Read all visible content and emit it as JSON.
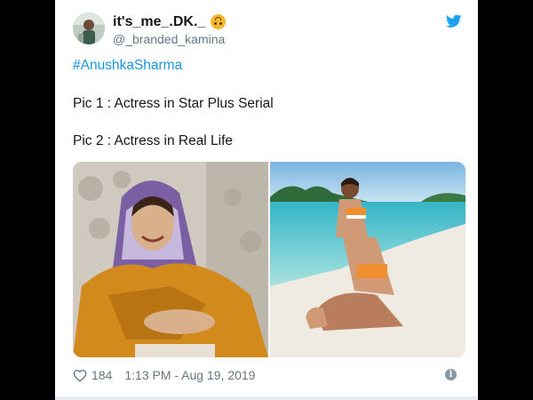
{
  "tweet": {
    "display_name": "it's_me_.DK._",
    "handle": "@_branded_kamina",
    "hashtag": "#AnushkaSharma",
    "lines": [
      "Pic 1 : Actress in Star Plus Serial",
      "Pic 2 : Actress in Real Life"
    ],
    "likes": "184",
    "timestamp": "1:13 PM - Aug 19, 2019"
  },
  "icons": {
    "brand": "twitter-bird-icon",
    "emoji": "upside-down-face-emoji",
    "like": "heart-icon",
    "info": "info-icon"
  },
  "colors": {
    "accent": "#1b95e0",
    "text": "#14171a",
    "muted": "#657786",
    "background": "#000000"
  }
}
